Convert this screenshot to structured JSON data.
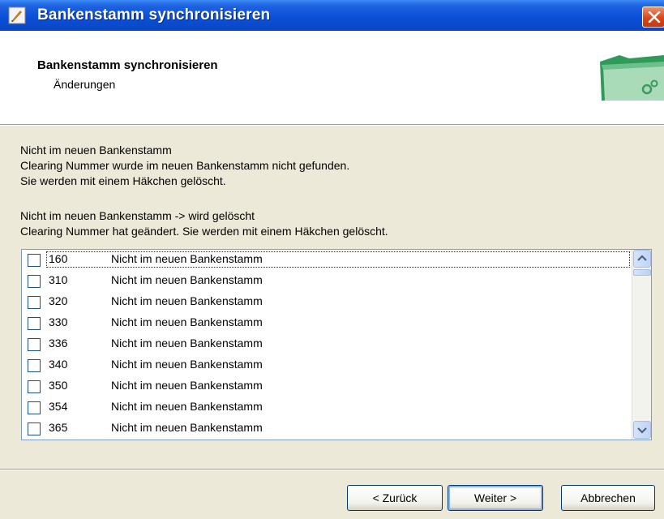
{
  "window": {
    "title": "Bankenstamm synchronisieren",
    "colors": {
      "titlebar": "#0a50d8",
      "close": "#d9461b",
      "dialog_bg": "#ece9d8"
    }
  },
  "header": {
    "title": "Bankenstamm synchronisieren",
    "subtitle": "Änderungen",
    "icon": "folder-gears-icon"
  },
  "description": {
    "block1": [
      "Nicht im neuen Bankenstamm",
      "Clearing Nummer wurde im neuen Bankenstamm nicht gefunden.",
      "Sie werden mit einem Häkchen gelöscht."
    ],
    "block2": [
      "Nicht im neuen Bankenstamm -> wird gelöscht",
      "Clearing Nummer hat geändert. Sie werden mit einem Häkchen gelöscht."
    ]
  },
  "list": {
    "items": [
      {
        "code": "160",
        "text": "Nicht im neuen Bankenstamm",
        "checked": false
      },
      {
        "code": "310",
        "text": "Nicht im neuen Bankenstamm",
        "checked": false
      },
      {
        "code": "320",
        "text": "Nicht im neuen Bankenstamm",
        "checked": false
      },
      {
        "code": "330",
        "text": "Nicht im neuen Bankenstamm",
        "checked": false
      },
      {
        "code": "336",
        "text": "Nicht im neuen Bankenstamm",
        "checked": false
      },
      {
        "code": "340",
        "text": "Nicht im neuen Bankenstamm",
        "checked": false
      },
      {
        "code": "350",
        "text": "Nicht im neuen Bankenstamm",
        "checked": false
      },
      {
        "code": "354",
        "text": "Nicht im neuen Bankenstamm",
        "checked": false
      },
      {
        "code": "365",
        "text": "Nicht im neuen Bankenstamm",
        "checked": false
      }
    ]
  },
  "buttons": {
    "back": "< Zurück",
    "next": "Weiter >",
    "cancel": "Abbrechen"
  }
}
